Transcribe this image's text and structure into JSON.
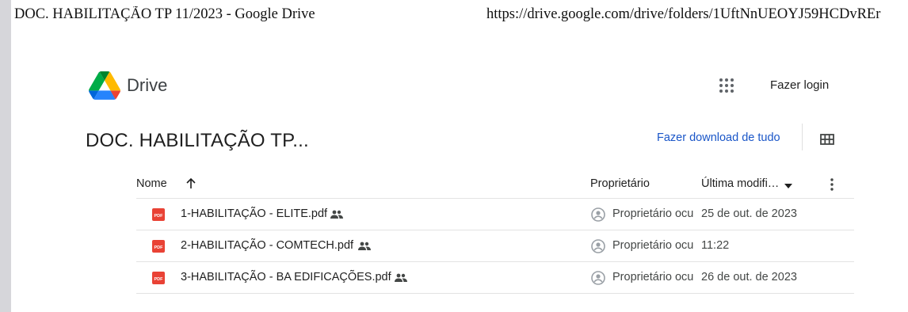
{
  "print_header": {
    "title": "DOC. HABILITAÇÃO TP 11/2023 - Google Drive",
    "url": "https://drive.google.com/drive/folders/1UftNnUEOYJ59HCDvREr"
  },
  "app": {
    "name": "Drive",
    "logo_icon": "google-drive-logo",
    "apps_icon": "apps-grid-icon",
    "login_label": "Fazer login"
  },
  "folder": {
    "title": "DOC. HABILITAÇÃO TP...",
    "download_label": "Fazer download de tudo",
    "view_icon": "grid-view-icon"
  },
  "table": {
    "columns": {
      "name": "Nome",
      "owner": "Proprietário",
      "modified": "Última modifi…"
    },
    "sort_icon": "arrow-up-icon",
    "rows": [
      {
        "name": "1-HABILITAÇÃO - ELITE.pdf",
        "owner": "Proprietário oculto",
        "modified": "25 de out. de 2023"
      },
      {
        "name": "2-HABILITAÇÃO - COMTECH.pdf",
        "owner": "Proprietário oculto",
        "modified": "11:22"
      },
      {
        "name": "3-HABILITAÇÃO -  BA EDIFICAÇÕES.pdf",
        "owner": "Proprietário oculto",
        "modified": "26 de out. de 2023"
      }
    ]
  },
  "colors": {
    "link_blue": "#1a56c8",
    "pdf_red": "#e94235",
    "divider": "#e3e3e3"
  }
}
